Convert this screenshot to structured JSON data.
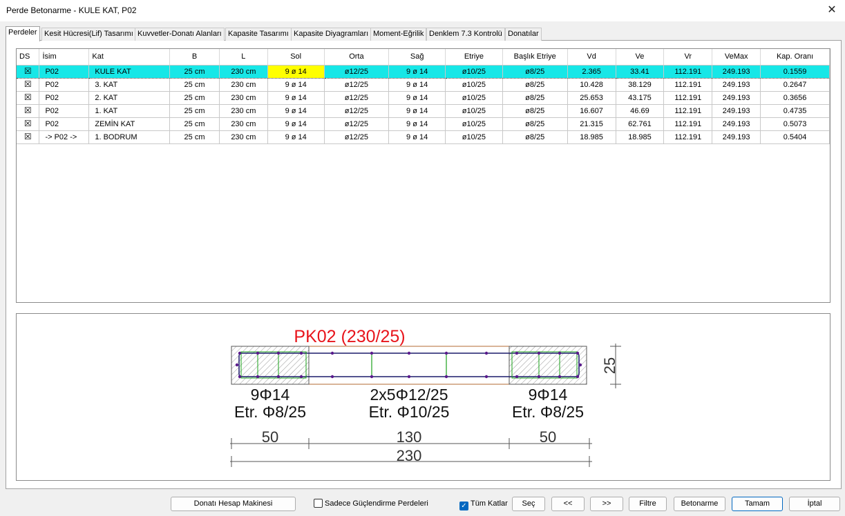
{
  "window": {
    "title": "Perde Betonarme - KULE KAT, P02",
    "close_glyph": "✕"
  },
  "tabs": [
    {
      "label": "Perdeler",
      "active": true
    },
    {
      "label": "Kesit Hücresi(Lif) Tasarımı"
    },
    {
      "label": "Kuvvetler-Donatı Alanları"
    },
    {
      "label": "Kapasite Tasarımı"
    },
    {
      "label": "Kapasite Diyagramları"
    },
    {
      "label": "Moment-Eğrilik"
    },
    {
      "label": "Denklem 7.3 Kontrolü"
    },
    {
      "label": "Donatılar"
    }
  ],
  "grid": {
    "columns": [
      "DS",
      "İsim",
      "Kat",
      "B",
      "L",
      "Sol",
      "Orta",
      "Sağ",
      "Etriye",
      "Başlık Etriye",
      "Vd",
      "Ve",
      "Vr",
      "VeMax",
      "Kap. Oranı"
    ],
    "check_glyph": "☒",
    "rows": [
      {
        "name": "P02",
        "floor": "KULE KAT",
        "b": "25 cm",
        "l": "230 cm",
        "sol": "9 ø 14",
        "orta": "ø12/25",
        "sag": "9 ø 14",
        "etriye": "ø10/25",
        "baslik": "ø8/25",
        "vd": "2.365",
        "ve": "33.41",
        "vr": "112.191",
        "vemax": "249.193",
        "kap": "0.1559"
      },
      {
        "name": "P02",
        "floor": "3. KAT",
        "b": "25 cm",
        "l": "230 cm",
        "sol": "9 ø 14",
        "orta": "ø12/25",
        "sag": "9 ø 14",
        "etriye": "ø10/25",
        "baslik": "ø8/25",
        "vd": "10.428",
        "ve": "38.129",
        "vr": "112.191",
        "vemax": "249.193",
        "kap": "0.2647"
      },
      {
        "name": "P02",
        "floor": "2. KAT",
        "b": "25 cm",
        "l": "230 cm",
        "sol": "9 ø 14",
        "orta": "ø12/25",
        "sag": "9 ø 14",
        "etriye": "ø10/25",
        "baslik": "ø8/25",
        "vd": "25.653",
        "ve": "43.175",
        "vr": "112.191",
        "vemax": "249.193",
        "kap": "0.3656"
      },
      {
        "name": "P02",
        "floor": "1. KAT",
        "b": "25 cm",
        "l": "230 cm",
        "sol": "9 ø 14",
        "orta": "ø12/25",
        "sag": "9 ø 14",
        "etriye": "ø10/25",
        "baslik": "ø8/25",
        "vd": "16.607",
        "ve": "46.69",
        "vr": "112.191",
        "vemax": "249.193",
        "kap": "0.4735"
      },
      {
        "name": "P02",
        "floor": "ZEMİN KAT",
        "b": "25 cm",
        "l": "230 cm",
        "sol": "9 ø 14",
        "orta": "ø12/25",
        "sag": "9 ø 14",
        "etriye": "ø10/25",
        "baslik": "ø8/25",
        "vd": "21.315",
        "ve": "62.761",
        "vr": "112.191",
        "vemax": "249.193",
        "kap": "0.5073"
      },
      {
        "name": "-> P02 ->",
        "floor": "1. BODRUM",
        "b": "25 cm",
        "l": "230 cm",
        "sol": "9 ø 14",
        "orta": "ø12/25",
        "sag": "9 ø 14",
        "etriye": "ø10/25",
        "baslik": "ø8/25",
        "vd": "18.985",
        "ve": "18.985",
        "vr": "112.191",
        "vemax": "249.193",
        "kap": "0.5404"
      }
    ]
  },
  "drawing": {
    "title": "PK02 (230/25)",
    "left_bars": "9Φ14",
    "left_stirrup": "Etr. Φ8/25",
    "mid_bars": "2x5Φ12/25",
    "mid_stirrup": "Etr. Φ10/25",
    "right_bars": "9Φ14",
    "right_stirrup": "Etr. Φ8/25",
    "dim_left": "50",
    "dim_mid": "130",
    "dim_right": "50",
    "dim_total": "230",
    "dim_thickness": "25",
    "colors": {
      "title": "#e8141b",
      "section_edge": "#b36a30",
      "stirrup": "#1aa01a",
      "bar": "#5a1a8c",
      "outline": "#1a1a6a"
    }
  },
  "footer": {
    "calculator_button": "Donatı Hesap Makinesi",
    "only_strengthen_label": "Sadece Güçlendirme Perdeleri",
    "only_strengthen_checked": false,
    "all_floors_label": "Tüm Katlar",
    "all_floors_checked": true,
    "select_button": "Seç",
    "prev_button": "<<",
    "next_button": ">>",
    "filter_button": "Filtre",
    "concrete_button": "Betonarme",
    "ok_button": "Tamam",
    "cancel_button": "İptal"
  }
}
